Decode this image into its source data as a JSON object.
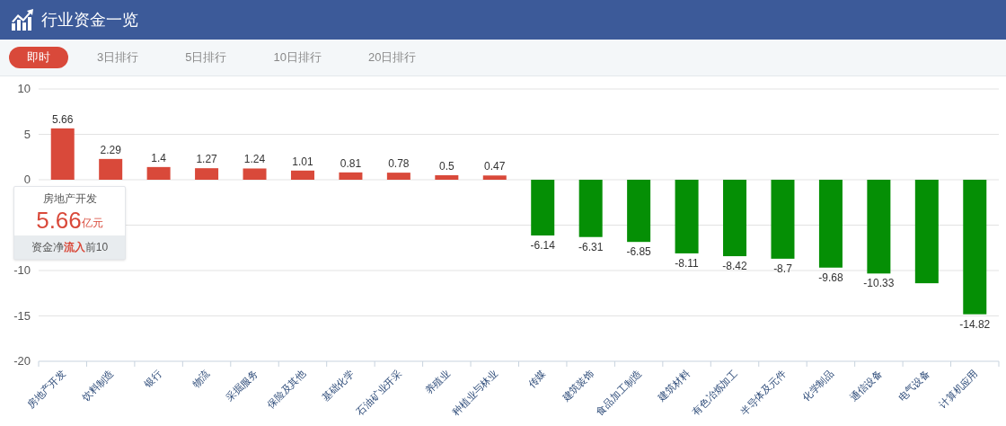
{
  "header": {
    "title": "行业资金一览"
  },
  "tabs": [
    {
      "label": "即时",
      "selected": true
    },
    {
      "label": "3日排行",
      "selected": false
    },
    {
      "label": "5日排行",
      "selected": false
    },
    {
      "label": "10日排行",
      "selected": false
    },
    {
      "label": "20日排行",
      "selected": false
    }
  ],
  "chart": {
    "chart_data": {
      "type": "bar",
      "categories": [
        "房地产开发",
        "饮料制造",
        "银行",
        "物流",
        "采掘服务",
        "保险及其他",
        "基础化学",
        "石油矿业开采",
        "养殖业",
        "种植业与林业",
        "传媒",
        "建筑装饰",
        "食品加工制造",
        "建筑材料",
        "有色冶炼加工",
        "半导体及元件",
        "化学制品",
        "通信设备",
        "电气设备",
        "计算机应用"
      ],
      "series": [
        {
          "color": "#d9493a",
          "values": [
            5.66,
            2.29,
            1.4,
            1.27,
            1.24,
            1.01,
            0.81,
            0.78,
            0.5,
            0.47,
            null,
            null,
            null,
            null,
            null,
            null,
            null,
            null,
            null,
            null
          ]
        },
        {
          "color": "#058f05",
          "values": [
            null,
            null,
            null,
            null,
            null,
            null,
            null,
            null,
            null,
            null,
            -6.14,
            -6.31,
            -6.85,
            -8.11,
            -8.42,
            -8.7,
            -9.68,
            -10.33,
            -11.4,
            -14.82
          ]
        }
      ],
      "grid": true,
      "ylim": [
        -20,
        10
      ],
      "yticks": [
        10,
        5,
        0,
        -10,
        -15,
        -20
      ],
      "value_labels": [
        "5.66",
        "2.29",
        "1.4",
        "1.27",
        "1.24",
        "1.01",
        "0.81",
        "0.78",
        "0.5",
        "0.47",
        "-6.14",
        "-6.31",
        "-6.85",
        "-8.11",
        "-8.42",
        "-8.7",
        "-9.68",
        "-10.33",
        null,
        "-14.82"
      ]
    }
  },
  "tooltip": {
    "title": "房地产开发",
    "value": "5.66",
    "unit": "亿元",
    "footer": "资金净**流入**前10"
  }
}
